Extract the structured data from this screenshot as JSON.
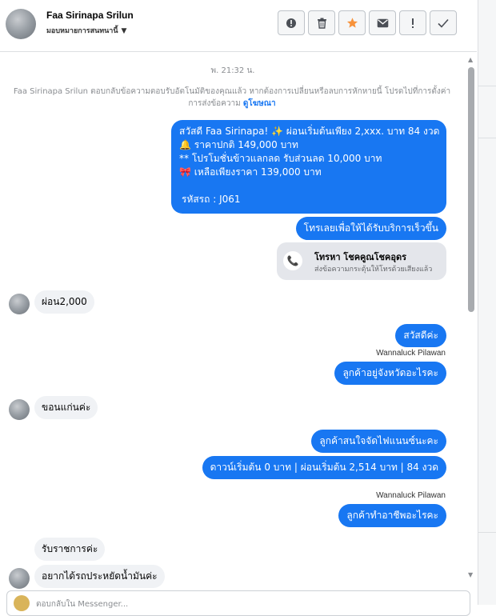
{
  "header": {
    "name": "Faa Sirinapa Srilun",
    "subtitle": "มอบหมายการสนทนานี้",
    "actions": [
      {
        "name": "report-icon",
        "glyph": "!"
      },
      {
        "name": "trash-icon",
        "glyph": "🗑"
      },
      {
        "name": "star-icon",
        "glyph": "★"
      },
      {
        "name": "mail-icon",
        "glyph": "✉"
      },
      {
        "name": "exclamation-icon",
        "glyph": "!"
      },
      {
        "name": "check-icon",
        "glyph": "✓"
      }
    ]
  },
  "chat": {
    "timestamp": "พ. 21:32 น.",
    "notice": "Faa Sirinapa Srilun ตอบกลับข้อความตอบรับอัตโนมัติของคุณแล้ว หากต้องการเปลี่ยนหรือลบการหักหายนี้ โปรดไปที่การตั้งค่าการส่งข้อความ",
    "notice_link": "ดูโฆษณา",
    "offer": {
      "line1": "สวัสดี Faa Sirinapa! ✨  ผ่อนเริ่มต้นเพียง 2,xxx. บาท 84 งวด",
      "line2": "🔔 ราคาปกติ 149,000 บาท",
      "line3": "** โปรโมชั่นข้าวแลกลด รับส่วนลด 10,000 บาท",
      "line4": "🎀  เหลือเพียงราคา 139,000 บาท",
      "line5": "รหัสรถ : J061"
    },
    "call_prompt": "โทรเลยเพื่อให้ได้รับบริการเร็วขึ้น",
    "call_card": {
      "title": "โทรหา โชคคูณโชคอุดร",
      "subtitle": "ส่งข้อความกระตุ้นให้โทรด้วยเสียงแล้ว"
    },
    "in1": "ผ่อน2,000",
    "out_hello": "สวัสดีค่ะ",
    "sender1": "Wannaluck Pilawan",
    "out_where": "ลูกค้าอยู่จังหวัดอะไรคะ",
    "in2": "ขอนแก่นค่ะ",
    "out_interest": "ลูกค้าสนใจจัดไฟแนนซ์นะคะ",
    "out_terms": "ดาวน์เริ่มต้น 0 บาท | ผ่อนเริ่มต้น 2,514 บาท | 84 งวด",
    "sender2": "Wannaluck Pilawan",
    "out_job": "ลูกค้าทำอาชีพอะไรคะ",
    "in3": "รับราชการค่ะ",
    "in4": "อยากได้รถประหยัดน้ำมันค่ะ"
  },
  "composer": {
    "placeholder": "ตอบกลับใน Messenger..."
  }
}
